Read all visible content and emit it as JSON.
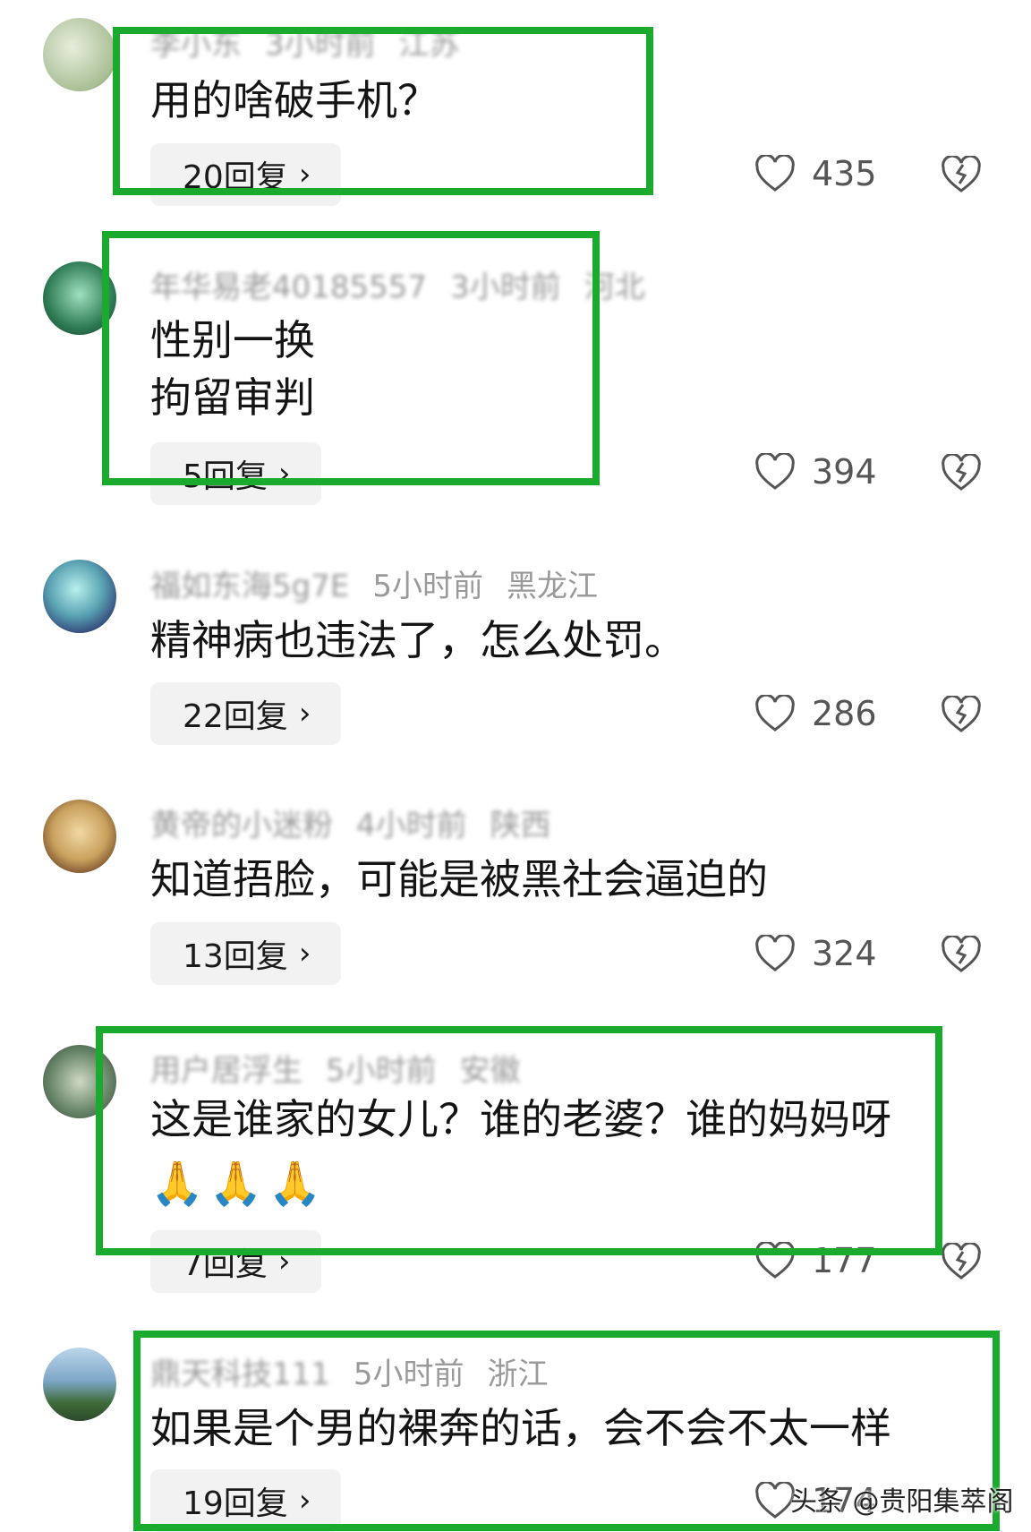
{
  "comments": [
    {
      "meta": [
        "李小东",
        "3小时前",
        "江苏"
      ],
      "text": "用的啥破手机？",
      "reply_label": "20回复",
      "likes": "435",
      "avatar_colors": [
        "#d7e2c8",
        "#6d8f5a"
      ]
    },
    {
      "meta": [
        "年华易老40185557",
        "3小时前",
        "河北"
      ],
      "text": "性别一换\n拘留审判",
      "reply_label": "5回复",
      "likes": "394",
      "avatar_colors": [
        "#1e5a3c",
        "#7fc4a0"
      ]
    },
    {
      "meta": [
        "福如东海5g7E",
        "5小时前",
        "黑龙江"
      ],
      "text": "精神病也违法了，怎么处罚。",
      "reply_label": "22回复",
      "likes": "286",
      "avatar_colors": [
        "#3a4f86",
        "#9bd6d3"
      ]
    },
    {
      "meta": [
        "黄帝的小迷粉",
        "4小时前",
        "陕西"
      ],
      "text": "知道捂脸，可能是被黑社会逼迫的",
      "reply_label": "13回复",
      "likes": "324",
      "avatar_colors": [
        "#c9a15e",
        "#6b3f22"
      ]
    },
    {
      "meta": [
        "用户居浮生",
        "5小时前",
        "安徽"
      ],
      "text": "这是谁家的女儿？谁的老婆？谁的妈妈呀",
      "emoji": "🙏🙏🙏",
      "reply_label": "7回复",
      "likes": "177",
      "avatar_colors": [
        "#4c6b52",
        "#a8b89c"
      ]
    },
    {
      "meta": [
        "鼎天科技111",
        "5小时前",
        "浙江"
      ],
      "text": "如果是个男的裸奔的话，会不会不太一样",
      "reply_label": "19回复",
      "likes": "174",
      "avatar_colors": [
        "#7ea7c9",
        "#3f6b3a"
      ]
    }
  ],
  "watermark": "头条 @贵阳集萃阁",
  "colors": {
    "highlight": "#1aab2e",
    "reply_bg": "#f2f2f2",
    "meta": "#9a9a9a"
  }
}
